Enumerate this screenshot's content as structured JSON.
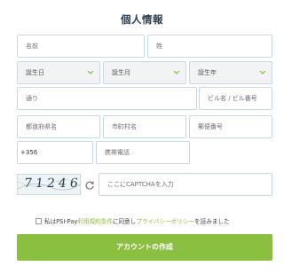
{
  "title": "個人情報",
  "fields": {
    "first_name": "名前",
    "last_name": "姓",
    "birth_day": "誕生日",
    "birth_month": "誕生月",
    "birth_year": "誕生年",
    "street": "通り",
    "building": "ビル名 / ビル番号",
    "prefecture": "都道府県名",
    "city": "市町村名",
    "postal_code": "郵便番号",
    "country_code": "+356",
    "mobile": "携帯電話",
    "captcha_placeholder": "ここにCAPTCHAを入力"
  },
  "captcha": {
    "image_text": "712461"
  },
  "terms": {
    "prefix": "私はPSI-Pay",
    "link1": "利用規約条件",
    "middle": "に同意し",
    "link2": "プライバシーポリシー",
    "suffix": "を読みました"
  },
  "submit_label": "アカウントの作成",
  "colors": {
    "accent": "#8bbf3f",
    "border": "#c7d9e9",
    "link": "#8fba34"
  },
  "icons": {
    "chevron": "chevron-down-icon",
    "refresh": "refresh-icon"
  }
}
